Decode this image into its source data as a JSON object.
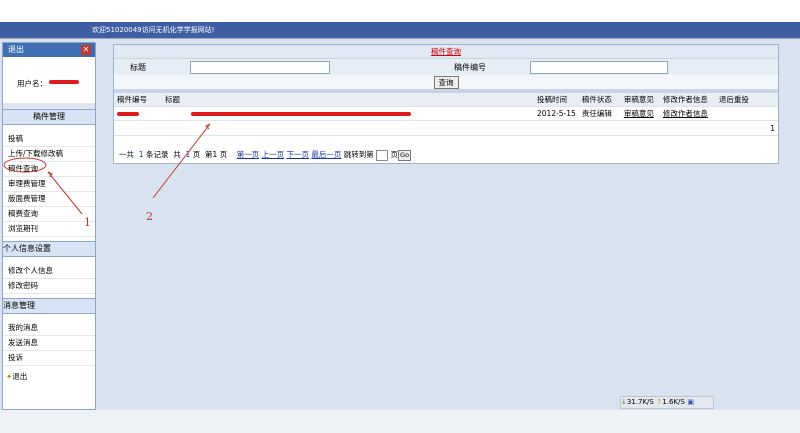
{
  "banner": {
    "welcome": "欢迎51020049访问无机化学学报网站!"
  },
  "sidebar": {
    "logout_label": "退出",
    "username_label": "用户名：",
    "sections": [
      {
        "title": "稿件管理",
        "items": [
          "投稿",
          "上传/下载修改稿",
          "稿件查询",
          "审理费管理",
          "版面费管理",
          "稿费查询",
          "浏览期刊"
        ]
      },
      {
        "title": "个人信息设置",
        "items": [
          "修改个人信息",
          "修改密码"
        ]
      },
      {
        "title": "消息管理",
        "items": [
          "我的消息",
          "发送消息",
          "投诉"
        ]
      }
    ],
    "exit_link": "退出"
  },
  "main": {
    "title": "稿件查询",
    "search": {
      "title_label": "标题",
      "number_label": "稿件编号",
      "query_button": "查询",
      "title_value": "",
      "number_value": ""
    },
    "columns": [
      "稿件编号",
      "标题",
      "投稿时间",
      "稿件状态",
      "审稿意见",
      "修改作者信息",
      "退后重投"
    ],
    "rows": [
      {
        "number": "",
        "title": "",
        "date": "2012-5-15",
        "status": "责任编辑",
        "review": "审稿意见",
        "modify": "修改作者信息",
        "resubmit": ""
      }
    ],
    "row_count_cell": "1",
    "pager": {
      "total_prefix": "一共",
      "total_count": "1",
      "total_unit": "条记录",
      "pages_prefix": "共",
      "pages_count": "1",
      "pages_unit": "页",
      "current_prefix": "第1",
      "current_unit": "页",
      "first": "第一页",
      "prev": "上一页",
      "next": "下一页",
      "last": "最后一页",
      "jump_label": "跳转到第",
      "page_unit": "页",
      "go": "Go"
    }
  },
  "annotations": {
    "one": "1",
    "two": "2"
  },
  "status_bar": {
    "download": "31.7K/S",
    "upload": "1.6K/S"
  }
}
